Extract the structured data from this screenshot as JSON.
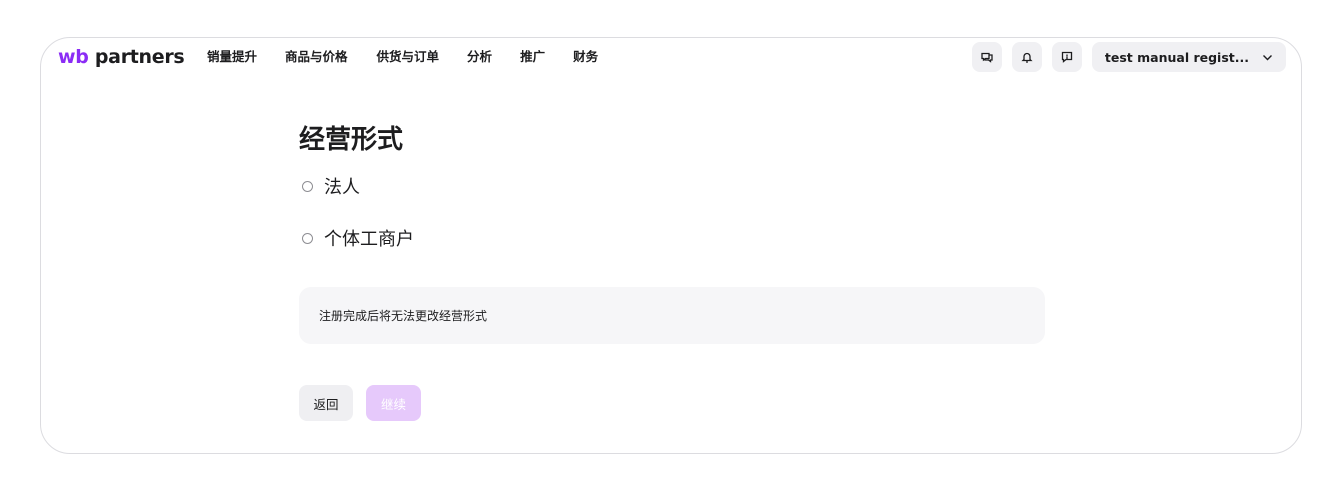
{
  "header": {
    "logo_wb": "wb",
    "logo_partners": " partners",
    "nav": [
      "销量提升",
      "商品与价格",
      "供货与订单",
      "分析",
      "推广",
      "财务"
    ],
    "icons": [
      "chat-icon",
      "bell-icon",
      "feedback-icon"
    ],
    "account_label": "test manual regist...",
    "account_chevron": "chevron-down-icon"
  },
  "form": {
    "title": "经营形式",
    "options": [
      {
        "label": "法人",
        "selected": false
      },
      {
        "label": "个体工商户",
        "selected": false
      }
    ],
    "notice": "注册完成后将无法更改经营形式",
    "back_label": "返回",
    "continue_label": "继续",
    "continue_disabled": true
  },
  "colors": {
    "brand": "#8b2cf5",
    "continue_disabled_bg": "#e6c9fb",
    "notice_bg": "#f6f6f8"
  }
}
